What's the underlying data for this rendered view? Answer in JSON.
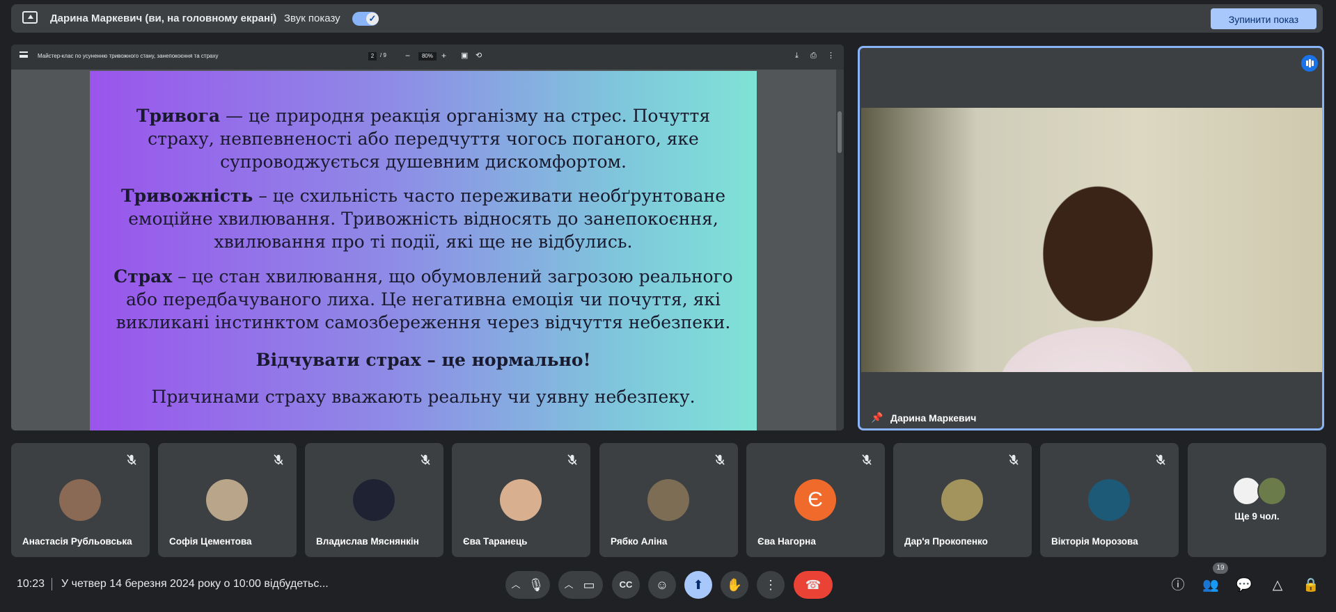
{
  "top_bar": {
    "presenter_title": "Дарина Маркевич (ви, на головному екрані)",
    "sound_label": "Звук показу",
    "stop_button": "Зупинити показ"
  },
  "pdf": {
    "title": "Майстер-клас по усуненню тривожного стану, занепокоєння та страху",
    "page": "2",
    "total_pages": "/  9",
    "zoom": "80%",
    "slide": [
      {
        "term": "Тривога",
        "text": " — це природня реакція організму на стрес. Почуття страху, невпевненості або передчуття чогось поганого, яке супроводжується душевним дискомфортом."
      },
      {
        "term": "Тривожність",
        "text": " – це схильність часто переживати необґрунтоване емоційне хвилювання. Тривожність відносять до занепокоєння, хвилювання про ті події, які ще не відбулись."
      },
      {
        "term": "Страх",
        "text": " – це стан хвилювання, що обумовлений загрозою реального або передбачуваного лиха. Це негативна емоція чи почуття, які викликані інстинктом самозбереження через відчуття небезпеки."
      },
      {
        "term": "Відчувати страх – це нормально!",
        "text": ""
      },
      {
        "term": "",
        "text": "Причинами страху вважають реальну чи уявну небезпеку."
      }
    ]
  },
  "speaker": {
    "name": "Дарина Маркевич"
  },
  "participants": [
    {
      "name": "Анастасія Рубльовська",
      "avatar_color": "#8a6a55"
    },
    {
      "name": "Софія Цементова",
      "avatar_color": "#b9a58a"
    },
    {
      "name": "Владислав Мяснянкін",
      "avatar_color": "#1f2233"
    },
    {
      "name": "Єва Таранець",
      "avatar_color": "#d8b08f"
    },
    {
      "name": "Рябко Аліна",
      "avatar_color": "#7d6d55"
    },
    {
      "name": "Єва Нагорна",
      "avatar_color": "#f06a2b",
      "initial": "Є"
    },
    {
      "name": "Дар'я Прокопенко",
      "avatar_color": "#a3945e"
    },
    {
      "name": "Вікторія Морозова",
      "avatar_color": "#1d5a78"
    }
  ],
  "more": {
    "label": "Ще 9 чол."
  },
  "bottom": {
    "time": "10:23",
    "meeting_title": "У четвер 14 березня 2024 року о 10:00 відбудетьс...",
    "people_count": "19"
  }
}
